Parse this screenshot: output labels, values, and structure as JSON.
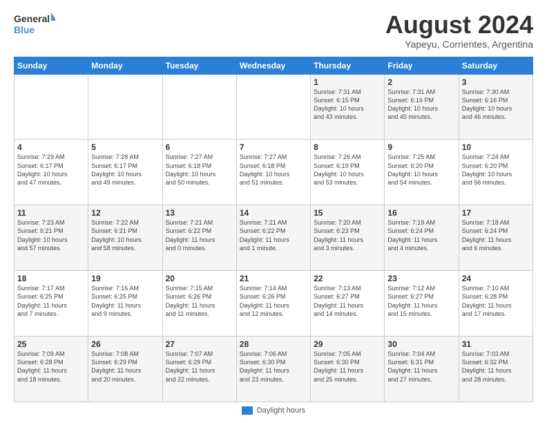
{
  "logo": {
    "line1": "General",
    "line2": "Blue"
  },
  "title": "August 2024",
  "subtitle": "Yapeyu, Corrientes, Argentina",
  "days_of_week": [
    "Sunday",
    "Monday",
    "Tuesday",
    "Wednesday",
    "Thursday",
    "Friday",
    "Saturday"
  ],
  "legend_label": "Daylight hours",
  "weeks": [
    [
      {
        "num": "",
        "info": ""
      },
      {
        "num": "",
        "info": ""
      },
      {
        "num": "",
        "info": ""
      },
      {
        "num": "",
        "info": ""
      },
      {
        "num": "1",
        "info": "Sunrise: 7:31 AM\nSunset: 6:15 PM\nDaylight: 10 hours\nand 43 minutes."
      },
      {
        "num": "2",
        "info": "Sunrise: 7:31 AM\nSunset: 6:16 PM\nDaylight: 10 hours\nand 45 minutes."
      },
      {
        "num": "3",
        "info": "Sunrise: 7:30 AM\nSunset: 6:16 PM\nDaylight: 10 hours\nand 46 minutes."
      }
    ],
    [
      {
        "num": "4",
        "info": "Sunrise: 7:29 AM\nSunset: 6:17 PM\nDaylight: 10 hours\nand 47 minutes."
      },
      {
        "num": "5",
        "info": "Sunrise: 7:28 AM\nSunset: 6:17 PM\nDaylight: 10 hours\nand 49 minutes."
      },
      {
        "num": "6",
        "info": "Sunrise: 7:27 AM\nSunset: 6:18 PM\nDaylight: 10 hours\nand 50 minutes."
      },
      {
        "num": "7",
        "info": "Sunrise: 7:27 AM\nSunset: 6:18 PM\nDaylight: 10 hours\nand 51 minutes."
      },
      {
        "num": "8",
        "info": "Sunrise: 7:26 AM\nSunset: 6:19 PM\nDaylight: 10 hours\nand 53 minutes."
      },
      {
        "num": "9",
        "info": "Sunrise: 7:25 AM\nSunset: 6:20 PM\nDaylight: 10 hours\nand 54 minutes."
      },
      {
        "num": "10",
        "info": "Sunrise: 7:24 AM\nSunset: 6:20 PM\nDaylight: 10 hours\nand 56 minutes."
      }
    ],
    [
      {
        "num": "11",
        "info": "Sunrise: 7:23 AM\nSunset: 6:21 PM\nDaylight: 10 hours\nand 57 minutes."
      },
      {
        "num": "12",
        "info": "Sunrise: 7:22 AM\nSunset: 6:21 PM\nDaylight: 10 hours\nand 58 minutes."
      },
      {
        "num": "13",
        "info": "Sunrise: 7:21 AM\nSunset: 6:22 PM\nDaylight: 11 hours\nand 0 minutes."
      },
      {
        "num": "14",
        "info": "Sunrise: 7:21 AM\nSunset: 6:22 PM\nDaylight: 11 hours\nand 1 minute."
      },
      {
        "num": "15",
        "info": "Sunrise: 7:20 AM\nSunset: 6:23 PM\nDaylight: 11 hours\nand 3 minutes."
      },
      {
        "num": "16",
        "info": "Sunrise: 7:19 AM\nSunset: 6:24 PM\nDaylight: 11 hours\nand 4 minutes."
      },
      {
        "num": "17",
        "info": "Sunrise: 7:18 AM\nSunset: 6:24 PM\nDaylight: 11 hours\nand 6 minutes."
      }
    ],
    [
      {
        "num": "18",
        "info": "Sunrise: 7:17 AM\nSunset: 6:25 PM\nDaylight: 11 hours\nand 7 minutes."
      },
      {
        "num": "19",
        "info": "Sunrise: 7:16 AM\nSunset: 6:25 PM\nDaylight: 11 hours\nand 9 minutes."
      },
      {
        "num": "20",
        "info": "Sunrise: 7:15 AM\nSunset: 6:26 PM\nDaylight: 11 hours\nand 11 minutes."
      },
      {
        "num": "21",
        "info": "Sunrise: 7:14 AM\nSunset: 6:26 PM\nDaylight: 11 hours\nand 12 minutes."
      },
      {
        "num": "22",
        "info": "Sunrise: 7:13 AM\nSunset: 6:27 PM\nDaylight: 11 hours\nand 14 minutes."
      },
      {
        "num": "23",
        "info": "Sunrise: 7:12 AM\nSunset: 6:27 PM\nDaylight: 11 hours\nand 15 minutes."
      },
      {
        "num": "24",
        "info": "Sunrise: 7:10 AM\nSunset: 6:28 PM\nDaylight: 11 hours\nand 17 minutes."
      }
    ],
    [
      {
        "num": "25",
        "info": "Sunrise: 7:09 AM\nSunset: 6:28 PM\nDaylight: 11 hours\nand 18 minutes."
      },
      {
        "num": "26",
        "info": "Sunrise: 7:08 AM\nSunset: 6:29 PM\nDaylight: 11 hours\nand 20 minutes."
      },
      {
        "num": "27",
        "info": "Sunrise: 7:07 AM\nSunset: 6:29 PM\nDaylight: 11 hours\nand 22 minutes."
      },
      {
        "num": "28",
        "info": "Sunrise: 7:06 AM\nSunset: 6:30 PM\nDaylight: 11 hours\nand 23 minutes."
      },
      {
        "num": "29",
        "info": "Sunrise: 7:05 AM\nSunset: 6:30 PM\nDaylight: 11 hours\nand 25 minutes."
      },
      {
        "num": "30",
        "info": "Sunrise: 7:04 AM\nSunset: 6:31 PM\nDaylight: 11 hours\nand 27 minutes."
      },
      {
        "num": "31",
        "info": "Sunrise: 7:03 AM\nSunset: 6:32 PM\nDaylight: 11 hours\nand 28 minutes."
      }
    ]
  ]
}
